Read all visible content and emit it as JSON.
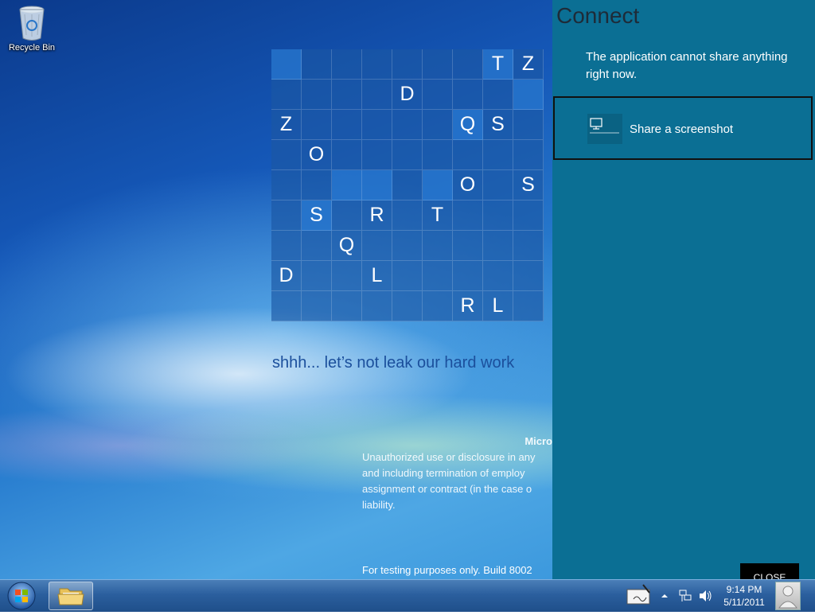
{
  "desktop": {
    "recycle_bin_label": "Recycle Bin",
    "grid": {
      "rows": [
        [
          "",
          "",
          "",
          "",
          "",
          "",
          "",
          "T",
          "Z"
        ],
        [
          "",
          "",
          "",
          "",
          "D",
          "",
          "",
          "",
          ""
        ],
        [
          "Z",
          "",
          "",
          "",
          "",
          "",
          "Q",
          "S",
          ""
        ],
        [
          "",
          "O",
          "",
          "",
          "",
          "",
          "",
          "",
          ""
        ],
        [
          "",
          "",
          "",
          "",
          "",
          "",
          "O",
          "",
          "S"
        ],
        [
          "",
          "S",
          "",
          "R",
          "",
          "T",
          "",
          "",
          ""
        ],
        [
          "",
          "",
          "Q",
          "",
          "",
          "",
          "",
          "",
          ""
        ],
        [
          "D",
          "",
          "",
          "L",
          "",
          "",
          "",
          "",
          ""
        ],
        [
          "",
          "",
          "",
          "",
          "",
          "",
          "R",
          "L",
          ""
        ]
      ]
    },
    "tagline": "shhh... let’s not leak our hard work",
    "legal_heading": "Micro",
    "legal_lines": "Unauthorized use or disclosure in any\nand including termination of employ\nassignment or contract (in the case o\nliability.",
    "watermark": "For testing purposes only. Build 8002"
  },
  "share_pane": {
    "title": "Connect",
    "message": "The application cannot share anything right now.",
    "item_label": "Share a screenshot",
    "close_label": "CLOSE"
  },
  "taskbar": {
    "time": "9:14 PM",
    "date": "5/11/2011"
  },
  "colors": {
    "pane_bg": "#0b6f94",
    "tagline": "#1b4f9c"
  }
}
